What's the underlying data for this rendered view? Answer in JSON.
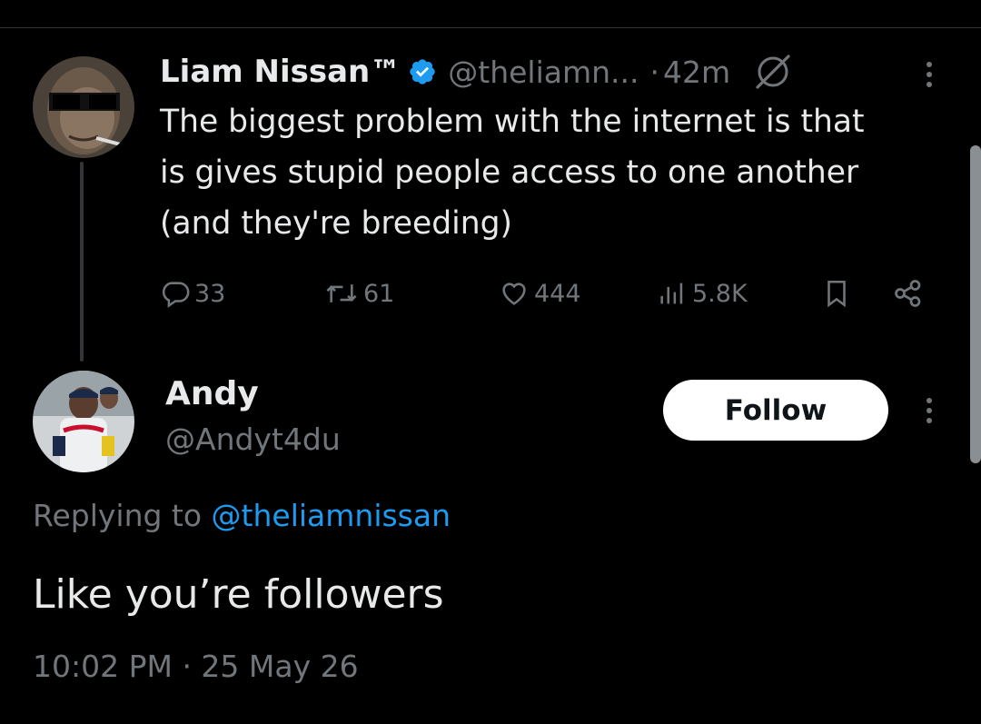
{
  "parent_tweet": {
    "display_name": "Liam Nissan™",
    "handle": "@theliamn...",
    "separator": "·",
    "time": "42m",
    "text_lines": [
      "The biggest problem with the internet is that",
      "is gives stupid people access to one another",
      "(and they're breeding)"
    ],
    "stats": {
      "replies": "33",
      "reposts": "61",
      "likes": "444",
      "views": "5.8K"
    }
  },
  "reply_tweet": {
    "display_name": "Andy",
    "handle": "@Andyt4du",
    "follow_label": "Follow",
    "replying_prefix": "Replying to",
    "replying_mention": "@theliamnissan",
    "text": "Like you’re followers",
    "timestamp": "10:02 PM · 25 May 26"
  },
  "icons": {
    "verified": "verified-badge-icon",
    "grok": "grok-icon",
    "more": "more-icon",
    "reply": "reply-icon",
    "repost": "repost-icon",
    "like": "heart-icon",
    "views": "views-icon",
    "bookmark": "bookmark-icon",
    "share": "share-icon"
  },
  "colors": {
    "background": "#000000",
    "text": "#e7e9ea",
    "secondary": "#71767b",
    "accent": "#1d9bf0",
    "follow_button_bg": "#ffffff"
  }
}
